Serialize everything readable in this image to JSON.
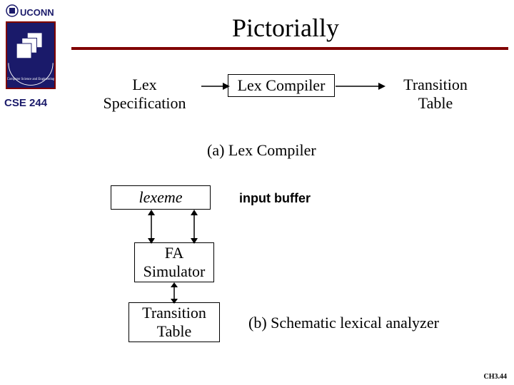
{
  "header": {
    "uconn": "UCONN",
    "course": "CSE 244",
    "title": "Pictorially"
  },
  "row_a": {
    "left": "Lex\nSpecification",
    "mid": "Lex Compiler",
    "right": "Transition\nTable",
    "caption": "(a)  Lex Compiler"
  },
  "row_b": {
    "lexeme": "lexeme",
    "input_buffer": "input buffer",
    "fa_sim": "FA\nSimulator",
    "trans_table": "Transition\nTable",
    "caption": "(b)  Schematic lexical analyzer"
  },
  "footer": "CH3.44"
}
